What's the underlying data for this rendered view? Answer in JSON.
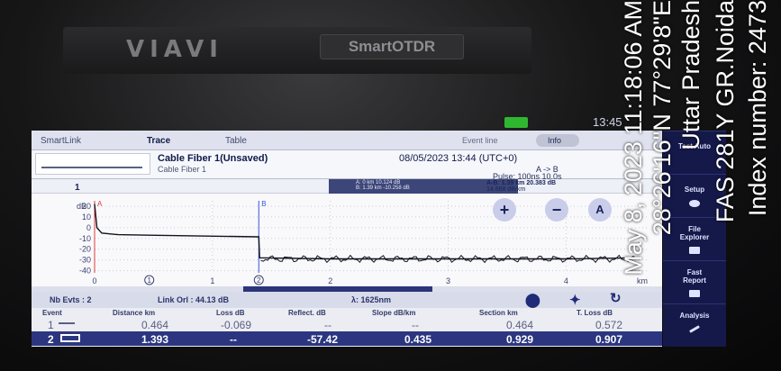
{
  "device": {
    "brand": "VIAVI",
    "model": "SmartOTDR",
    "clock": "13:45"
  },
  "tabs": {
    "smartlink": "SmartLink",
    "trace": "Trace",
    "table": "Table",
    "event_line": "Event line",
    "info": "Info"
  },
  "header": {
    "cable_name": "Cable Fiber 1(Unsaved)",
    "cable_sub": "Cable Fiber 1",
    "datetime": "08/05/2023 13:44 (UTC+0)",
    "direction": "A -> B",
    "pulse": "Pulse: 100ns   10.0s"
  },
  "markerbar": {
    "trace_number": "1",
    "marker_a": "A: 0 km  10.124 dB",
    "marker_b": "B: 1.39 km  -10.258 dB",
    "ab_distance": "A-B: 1.39 km  20.383 dB",
    "ab_slope": "14.668 dB/km"
  },
  "chart": {
    "ylabel": "dB",
    "xunit": "km",
    "marker_a_label": "A",
    "marker_b_label": "B",
    "zoom_in": "+",
    "zoom_out": "−",
    "auto_label": "A"
  },
  "chart_data": {
    "type": "line",
    "xlabel": "km",
    "ylabel": "dB",
    "x_ticks": [
      "0",
      "1",
      "2",
      "3",
      "4"
    ],
    "y_ticks": [
      "20",
      "10",
      "0",
      "-10",
      "-20",
      "-30",
      "-40"
    ],
    "xlim": [
      0,
      4.7
    ],
    "ylim": [
      -42,
      25
    ],
    "event_markers": [
      "1",
      "2"
    ],
    "series": [
      {
        "values": [
          [
            0,
            22
          ],
          [
            0.02,
            0
          ],
          [
            0.06,
            -5
          ],
          [
            0.2,
            -6.5
          ],
          [
            0.464,
            -7
          ],
          [
            1.393,
            -8.5
          ],
          [
            1.4,
            -28
          ],
          [
            2.0,
            -29
          ],
          [
            3.0,
            -29
          ],
          [
            4.0,
            -29
          ],
          [
            4.6,
            -28
          ]
        ]
      }
    ]
  },
  "summary": {
    "nb_evts": "Nb Evts : 2",
    "link_orl": "Link Orl :  44.13 dB",
    "wavelength": "λ: 1625nm"
  },
  "table": {
    "headers": [
      "Event",
      "Distance  km",
      "Loss dB",
      "Reflect. dB",
      "Slope  dB/km",
      "Section km",
      "T. Loss dB"
    ],
    "rows": [
      [
        "1",
        "0.464",
        "-0.069",
        "--",
        "--",
        "0.464",
        "0.572"
      ],
      [
        "2",
        "1.393",
        "--",
        "-57.42",
        "0.435",
        "0.929",
        "0.907"
      ]
    ]
  },
  "sidebar": [
    "Test\nAuto",
    "Setup",
    "File\nExplorer",
    "Fast\nReport",
    "Analysis"
  ],
  "overlay": [
    "May 8, 2023 11:18:06 AM",
    "28°26'16\"N 77°29'8\"E",
    "Uttar Pradesh",
    "FAS 281Y GR.Noida",
    "Index number: 2473"
  ],
  "colors": {
    "accent": "#2c3680",
    "sidebar": "#15194a",
    "marker": "#e03a3a"
  }
}
